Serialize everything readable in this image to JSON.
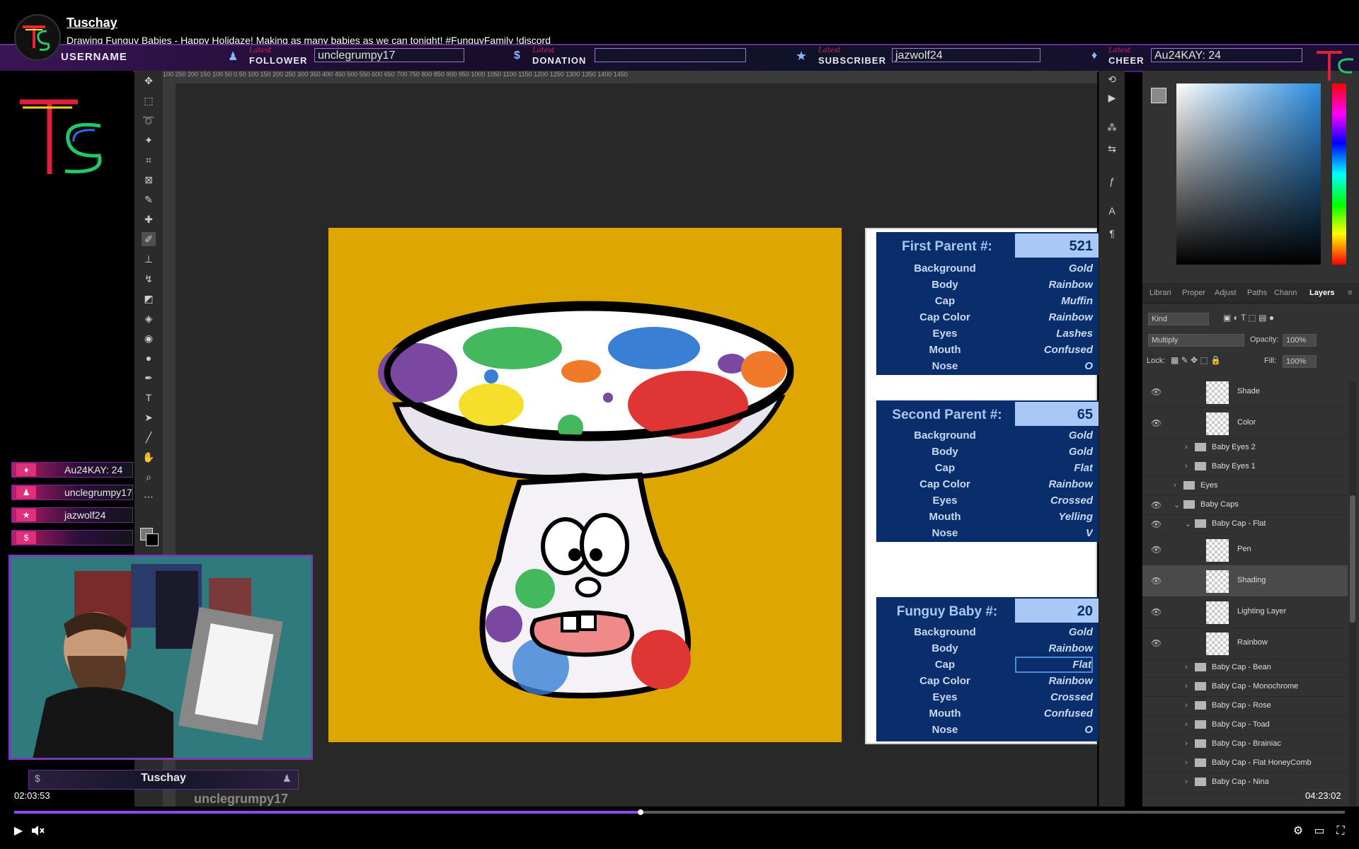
{
  "channel": {
    "name": "Tuschay",
    "title": "Drawing Funguy Babies - Happy Holidaze! Making as many babies as we can tonight! #FunguyFamily !discord"
  },
  "alert_bar": {
    "username_label": "USERNAME",
    "follower_tag": "Latest",
    "follower_label": "FOLLOWER",
    "follower_value": "unclegrumpy17",
    "donation_tag": "Latest",
    "donation_label": "DONATION",
    "donation_value": "",
    "subscriber_tag": "Latest",
    "subscriber_label": "SUBSCRIBER",
    "subscriber_value": "jazwolf24",
    "cheer_tag": "Latest",
    "cheer_label": "CHEER",
    "cheer_value": "Au24KAY: 24"
  },
  "recent_events": [
    {
      "icon": "cheer-icon",
      "glyph": "♦",
      "text": "Au24KAY: 24"
    },
    {
      "icon": "follower-icon",
      "glyph": "♟",
      "text": "unclegrumpy17"
    },
    {
      "icon": "subscriber-icon",
      "glyph": "★",
      "text": "jazwolf24"
    },
    {
      "icon": "donation-icon",
      "glyph": "$",
      "text": ""
    }
  ],
  "webcam": {
    "name": "Tuschay",
    "follower_name": "unclegrumpy17"
  },
  "ruler_ticks": "100  250  200  150  100   50    0    50   100  150  200  250  300  350  400  450  500  550  600  650  700  750  800  850  900  950  1000  1050  1100  1150  1200  1250  1300  1350  1400  1450",
  "sheet": {
    "first": {
      "title": "First Parent #:",
      "number": "521",
      "rows": [
        {
          "k": "Background",
          "v": "Gold"
        },
        {
          "k": "Body",
          "v": "Rainbow"
        },
        {
          "k": "Cap",
          "v": "Muffin"
        },
        {
          "k": "Cap Color",
          "v": "Rainbow"
        },
        {
          "k": "Eyes",
          "v": "Lashes"
        },
        {
          "k": "Mouth",
          "v": "Confused"
        },
        {
          "k": "Nose",
          "v": "O"
        }
      ]
    },
    "second": {
      "title": "Second Parent #:",
      "number": "65",
      "rows": [
        {
          "k": "Background",
          "v": "Gold"
        },
        {
          "k": "Body",
          "v": "Gold"
        },
        {
          "k": "Cap",
          "v": "Flat"
        },
        {
          "k": "Cap Color",
          "v": "Rainbow"
        },
        {
          "k": "Eyes",
          "v": "Crossed"
        },
        {
          "k": "Mouth",
          "v": "Yelling"
        },
        {
          "k": "Nose",
          "v": "V"
        }
      ]
    },
    "baby": {
      "title": "Funguy Baby #:",
      "number": "20",
      "rows": [
        {
          "k": "Background",
          "v": "Gold"
        },
        {
          "k": "Body",
          "v": "Rainbow"
        },
        {
          "k": "Cap",
          "v": "Flat"
        },
        {
          "k": "Cap Color",
          "v": "Rainbow"
        },
        {
          "k": "Eyes",
          "v": "Crossed"
        },
        {
          "k": "Mouth",
          "v": "Confused"
        },
        {
          "k": "Nose",
          "v": "O"
        }
      ]
    }
  },
  "layers_panel": {
    "tabs": [
      "Librari",
      "Proper",
      "Adjust",
      "Paths",
      "Chann",
      "Layers"
    ],
    "active_tab": "Layers",
    "kind_label": "Kind",
    "blend_mode": "Multiply",
    "opacity_label": "Opacity:",
    "opacity_value": "100%",
    "lock_label": "Lock:",
    "fill_label": "Fill:",
    "fill_value": "100%",
    "layers": [
      {
        "name": "Shade",
        "type": "layer",
        "visible": true,
        "indent": 0
      },
      {
        "name": "Color",
        "type": "layer",
        "visible": true,
        "indent": 0
      },
      {
        "name": "Baby Eyes 2",
        "type": "group",
        "visible": false,
        "indent": 1
      },
      {
        "name": "Baby Eyes 1",
        "type": "group",
        "visible": false,
        "indent": 1
      },
      {
        "name": "Eyes",
        "type": "group",
        "visible": false,
        "indent": 0
      },
      {
        "name": "Baby Caps",
        "type": "group-open",
        "visible": true,
        "indent": 0
      },
      {
        "name": "Baby Cap - Flat",
        "type": "group-open",
        "visible": true,
        "indent": 1
      },
      {
        "name": "Pen",
        "type": "layer",
        "visible": true,
        "indent": 2
      },
      {
        "name": "Shading",
        "type": "layer",
        "visible": true,
        "indent": 2,
        "selected": true
      },
      {
        "name": "Lighting Layer",
        "type": "layer",
        "visible": true,
        "indent": 2
      },
      {
        "name": "Rainbow",
        "type": "layer",
        "visible": true,
        "indent": 2
      },
      {
        "name": "Baby Cap - Bean",
        "type": "group",
        "visible": false,
        "indent": 1
      },
      {
        "name": "Baby Cap - Monochrome",
        "type": "group",
        "visible": false,
        "indent": 1
      },
      {
        "name": "Baby Cap - Rose",
        "type": "group",
        "visible": false,
        "indent": 1
      },
      {
        "name": "Baby Cap - Toad",
        "type": "group",
        "visible": false,
        "indent": 1
      },
      {
        "name": "Baby Cap - Brainiac",
        "type": "group",
        "visible": false,
        "indent": 1
      },
      {
        "name": "Baby Cap - Flat HoneyComb",
        "type": "group",
        "visible": false,
        "indent": 1
      },
      {
        "name": "Baby Cap - Nina",
        "type": "group",
        "visible": false,
        "indent": 1
      }
    ]
  },
  "player": {
    "current_time": "02:03:53",
    "total_time": "04:23:02",
    "progress": 0.471
  },
  "colors": {
    "accent": "#9147ff",
    "artboard": "#dda600",
    "sheet_blue": "#0a2e6c"
  }
}
